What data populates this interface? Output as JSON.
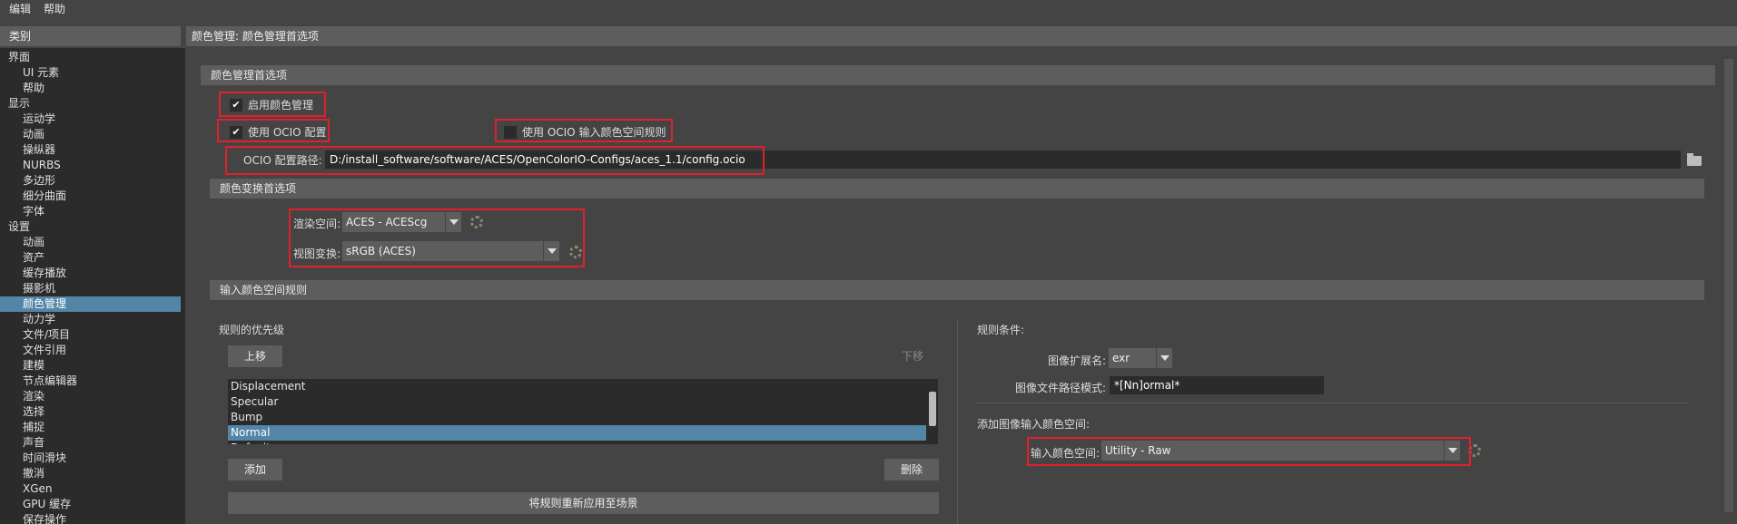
{
  "menu": {
    "items": [
      "编辑",
      "帮助"
    ]
  },
  "sidebar": {
    "header": "类别",
    "items": [
      {
        "label": "界面",
        "level": 0
      },
      {
        "label": "UI 元素",
        "level": 1
      },
      {
        "label": "帮助",
        "level": 1
      },
      {
        "label": "显示",
        "level": 0
      },
      {
        "label": "运动学",
        "level": 1
      },
      {
        "label": "动画",
        "level": 1
      },
      {
        "label": "操纵器",
        "level": 1
      },
      {
        "label": "NURBS",
        "level": 1
      },
      {
        "label": "多边形",
        "level": 1
      },
      {
        "label": "细分曲面",
        "level": 1
      },
      {
        "label": "字体",
        "level": 1
      },
      {
        "label": "设置",
        "level": 0
      },
      {
        "label": "动画",
        "level": 1
      },
      {
        "label": "资产",
        "level": 1
      },
      {
        "label": "缓存播放",
        "level": 1
      },
      {
        "label": "摄影机",
        "level": 1
      },
      {
        "label": "颜色管理",
        "level": 1,
        "selected": true
      },
      {
        "label": "动力学",
        "level": 1
      },
      {
        "label": "文件/项目",
        "level": 1
      },
      {
        "label": "文件引用",
        "level": 1
      },
      {
        "label": "建模",
        "level": 1
      },
      {
        "label": "节点编辑器",
        "level": 1
      },
      {
        "label": "渲染",
        "level": 1
      },
      {
        "label": "选择",
        "level": 1
      },
      {
        "label": "捕捉",
        "level": 1
      },
      {
        "label": "声音",
        "level": 1
      },
      {
        "label": "时间滑块",
        "level": 1
      },
      {
        "label": "撤消",
        "level": 1
      },
      {
        "label": "XGen",
        "level": 1
      },
      {
        "label": "GPU 缓存",
        "level": 1
      },
      {
        "label": "保存操作",
        "level": 1
      }
    ]
  },
  "main": {
    "header": "颜色管理: 颜色管理首选项",
    "prefs_section": {
      "title": "颜色管理首选项",
      "enable_cm": {
        "label": "启用颜色管理",
        "checked": true
      },
      "use_ocio": {
        "label": "使用 OCIO 配置",
        "checked": true
      },
      "use_ocio_rules": {
        "label": "使用 OCIO 输入颜色空间规则",
        "checked": false
      },
      "ocio_path_label": "OCIO 配置路径:",
      "ocio_path_value": "D:/install_software/software/ACES/OpenColorIO-Configs/aces_1.1/config.ocio"
    },
    "transform_section": {
      "title": "颜色变换首选项",
      "render_space_label": "渲染空间:",
      "render_space_value": "ACES - ACEScg",
      "view_transform_label": "视图变换:",
      "view_transform_value": "sRGB (ACES)"
    },
    "rules_section": {
      "title": "输入颜色空间规则",
      "priority_label": "规则的优先级",
      "move_up": "上移",
      "move_down": "下移",
      "rules": [
        "Displacement",
        "Specular",
        "Bump",
        "Normal",
        "Default"
      ],
      "selected_rule": "Normal",
      "add": "添加",
      "delete": "删除",
      "reapply": "将规则重新应用至场景",
      "conditions_label": "规则条件:",
      "ext_label": "图像扩展名:",
      "ext_value": "exr",
      "path_pattern_label": "图像文件路径模式:",
      "path_pattern_value": "*[Nn]ormal*",
      "add_input_space_label": "添加图像输入颜色空间:",
      "input_space_label": "输入颜色空间:",
      "input_space_value": "Utility - Raw"
    }
  },
  "colors": {
    "highlight": "#e0202c",
    "selection": "#5285a6"
  }
}
